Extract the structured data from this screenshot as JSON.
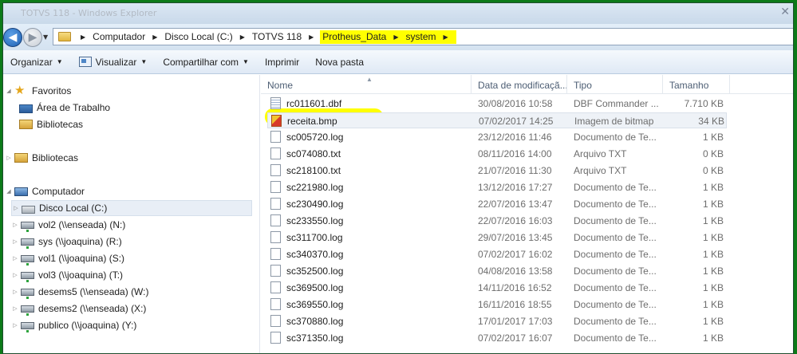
{
  "window": {
    "title": "TOTVS 118 - Windows Explorer",
    "accent_highlight": "#ffff00",
    "frame_color": "#0c7a18"
  },
  "address": {
    "crumbs": [
      "Computador",
      "Disco Local (C:)",
      "TOTVS 118"
    ],
    "highlighted_crumbs": [
      "Protheus_Data",
      "system"
    ]
  },
  "toolbar": {
    "organize": "Organizar",
    "view": "Visualizar",
    "share": "Compartilhar com",
    "print": "Imprimir",
    "new_folder": "Nova pasta"
  },
  "nav": {
    "favorites": "Favoritos",
    "desktop": "Área de Trabalho",
    "libraries_fav": "Bibliotecas",
    "libraries": "Bibliotecas",
    "computer": "Computador",
    "drives": [
      "Disco Local (C:)",
      "vol2 (\\\\enseada) (N:)",
      "sys (\\\\joaquina) (R:)",
      "vol1 (\\\\joaquina) (S:)",
      "vol3 (\\\\joaquina) (T:)",
      "desems5 (\\\\enseada) (W:)",
      "desems2 (\\\\enseada) (X:)",
      "publico (\\\\joaquina) (Y:)"
    ]
  },
  "columns": {
    "name": "Nome",
    "date": "Data de modificaçã...",
    "type": "Tipo",
    "size": "Tamanho"
  },
  "files": [
    {
      "name": "rc011601.dbf",
      "date": "30/08/2016 10:58",
      "type": "DBF Commander ...",
      "size": "7.710 KB",
      "icon": "dbf-icon"
    },
    {
      "name": "receita.bmp",
      "date": "07/02/2017 14:25",
      "type": "Imagem de bitmap",
      "size": "34 KB",
      "icon": "bitmap-icon"
    },
    {
      "name": "sc005720.log",
      "date": "23/12/2016 11:46",
      "type": "Documento de Te...",
      "size": "1 KB",
      "icon": "text-file-icon"
    },
    {
      "name": "sc074080.txt",
      "date": "08/11/2016 14:00",
      "type": "Arquivo TXT",
      "size": "0 KB",
      "icon": "text-file-icon"
    },
    {
      "name": "sc218100.txt",
      "date": "21/07/2016 11:30",
      "type": "Arquivo TXT",
      "size": "0 KB",
      "icon": "text-file-icon"
    },
    {
      "name": "sc221980.log",
      "date": "13/12/2016 17:27",
      "type": "Documento de Te...",
      "size": "1 KB",
      "icon": "text-file-icon"
    },
    {
      "name": "sc230490.log",
      "date": "22/07/2016 13:47",
      "type": "Documento de Te...",
      "size": "1 KB",
      "icon": "text-file-icon"
    },
    {
      "name": "sc233550.log",
      "date": "22/07/2016 16:03",
      "type": "Documento de Te...",
      "size": "1 KB",
      "icon": "text-file-icon"
    },
    {
      "name": "sc311700.log",
      "date": "29/07/2016 13:45",
      "type": "Documento de Te...",
      "size": "1 KB",
      "icon": "text-file-icon"
    },
    {
      "name": "sc340370.log",
      "date": "07/02/2017 16:02",
      "type": "Documento de Te...",
      "size": "1 KB",
      "icon": "text-file-icon"
    },
    {
      "name": "sc352500.log",
      "date": "04/08/2016 13:58",
      "type": "Documento de Te...",
      "size": "1 KB",
      "icon": "text-file-icon"
    },
    {
      "name": "sc369500.log",
      "date": "14/11/2016 16:52",
      "type": "Documento de Te...",
      "size": "1 KB",
      "icon": "text-file-icon"
    },
    {
      "name": "sc369550.log",
      "date": "16/11/2016 18:55",
      "type": "Documento de Te...",
      "size": "1 KB",
      "icon": "text-file-icon"
    },
    {
      "name": "sc370880.log",
      "date": "17/01/2017 17:03",
      "type": "Documento de Te...",
      "size": "1 KB",
      "icon": "text-file-icon"
    },
    {
      "name": "sc371350.log",
      "date": "07/02/2017 16:07",
      "type": "Documento de Te...",
      "size": "1 KB",
      "icon": "text-file-icon"
    }
  ]
}
